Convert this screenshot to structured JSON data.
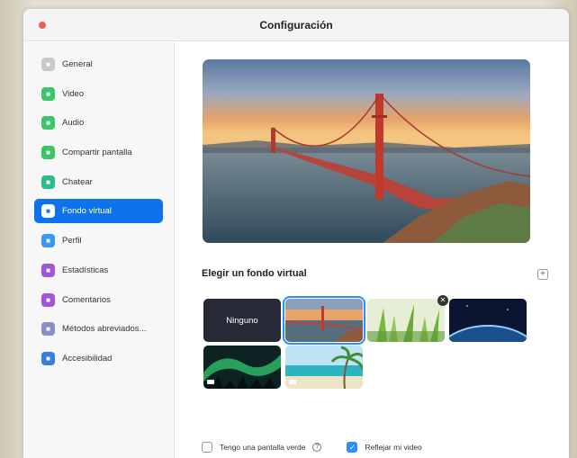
{
  "window": {
    "title": "Configuración"
  },
  "sidebar": {
    "items": [
      {
        "label": "General",
        "icon": "gear-icon",
        "color": "#c9c9c9",
        "active": false
      },
      {
        "label": "Video",
        "icon": "video-icon",
        "color": "#3ac567",
        "active": false
      },
      {
        "label": "Audio",
        "icon": "headphones-icon",
        "color": "#3ac567",
        "active": false
      },
      {
        "label": "Compartir pantalla",
        "icon": "share-screen-icon",
        "color": "#3ac567",
        "active": false
      },
      {
        "label": "Chatear",
        "icon": "chat-icon",
        "color": "#2dbd8a",
        "active": false
      },
      {
        "label": "Fondo virtual",
        "icon": "virtual-background-icon",
        "color": "#0e72ed",
        "active": true
      },
      {
        "label": "Perfil",
        "icon": "profile-icon",
        "color": "#3a97f4",
        "active": false
      },
      {
        "label": "Estadísticas",
        "icon": "statistics-icon",
        "color": "#a056d6",
        "active": false
      },
      {
        "label": "Comentarios",
        "icon": "feedback-icon",
        "color": "#a056d6",
        "active": false
      },
      {
        "label": "Métodos abreviados...",
        "icon": "keyboard-icon",
        "color": "#8a8fc9",
        "active": false
      },
      {
        "label": "Accesibilidad",
        "icon": "accessibility-icon",
        "color": "#3a7de0",
        "active": false
      }
    ]
  },
  "main": {
    "section_title": "Elegir un fondo virtual",
    "add_symbol": "+",
    "backgrounds": [
      {
        "label": "Ninguno",
        "kind": "none"
      },
      {
        "kind": "golden-gate-bridge",
        "selected": true
      },
      {
        "kind": "grass",
        "removable": true
      },
      {
        "kind": "earth-from-space"
      },
      {
        "kind": "aurora",
        "video": true
      },
      {
        "kind": "beach",
        "video": true
      }
    ],
    "green_screen": {
      "label": "Tengo una pantalla verde",
      "checked": false
    },
    "mirror_video": {
      "label": "Reflejar mi video",
      "checked": true
    }
  },
  "colors": {
    "accent": "#0e72ed",
    "close_button": "#ec5f56"
  }
}
